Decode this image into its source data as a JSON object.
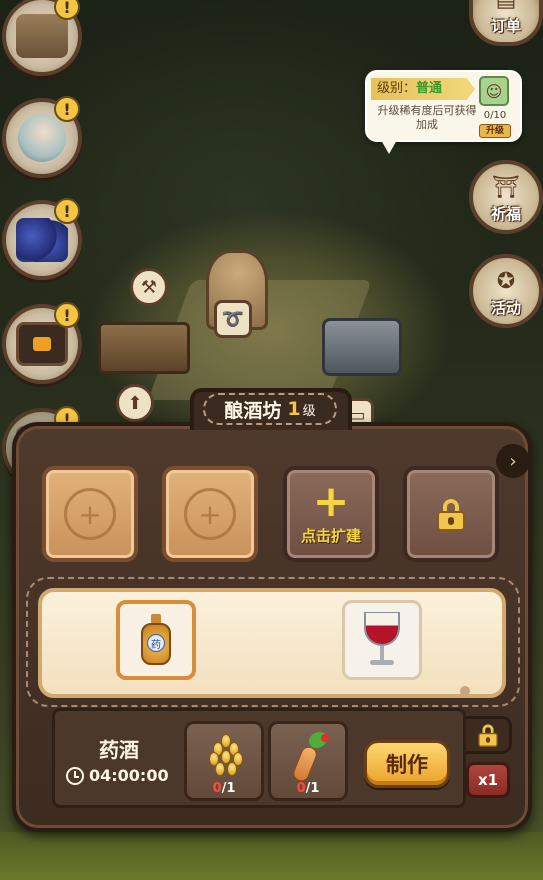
{
  "left_menu": {
    "items": [
      {
        "name": "workshop",
        "alert": "!"
      },
      {
        "name": "npc",
        "alert": "!"
      },
      {
        "name": "blueberry",
        "alert": "!"
      },
      {
        "name": "tv",
        "alert": "!"
      },
      {
        "name": "partial",
        "alert": "!"
      }
    ]
  },
  "right_menu": {
    "orders_label": "订单",
    "pray_label": "祈福",
    "activity_label": "活动"
  },
  "tooltip": {
    "level_prefix": "级别：",
    "level_value": "普通",
    "description": "升级稀有度后可获得加成",
    "progress": "0/10",
    "upgrade_label": "升级"
  },
  "panel": {
    "title": "酿酒坊",
    "level_number": "1",
    "level_unit": "级",
    "slots": [
      {
        "type": "empty"
      },
      {
        "type": "empty"
      },
      {
        "type": "expand",
        "label": "点击扩建",
        "plus": "+"
      },
      {
        "type": "locked"
      }
    ],
    "next_arrow": "›"
  },
  "recipes": {
    "items": [
      {
        "name": "medicinal-wine",
        "selected": true,
        "label_char": "药"
      },
      {
        "name": "red-wine",
        "selected": false
      }
    ]
  },
  "detail": {
    "recipe_name": "药酒",
    "duration": "04:00:00",
    "ingredients": [
      {
        "name": "grain",
        "have": "0",
        "need": "/1"
      },
      {
        "name": "ginseng",
        "have": "0",
        "need": "/1"
      }
    ],
    "make_label": "制作",
    "multiplier": "x1"
  },
  "colors": {
    "accent": "#f5c642",
    "panel_bg": "#4f3a2c",
    "make_button": "#e9a22a",
    "shortage_red": "#ff4a3a"
  }
}
